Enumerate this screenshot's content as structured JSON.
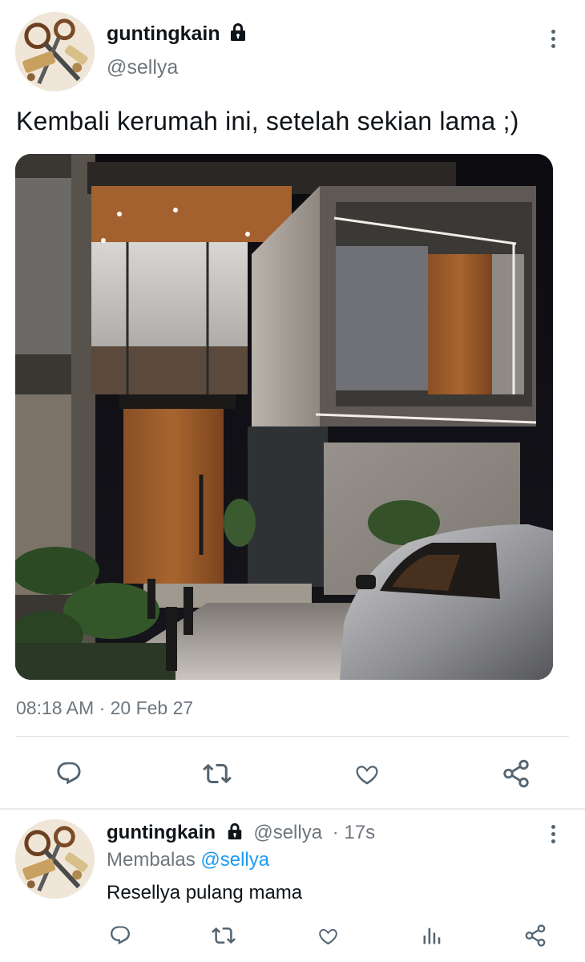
{
  "tweet": {
    "author_name": "guntingkain",
    "author_handle": "@sellya",
    "text": "Kembali kerumah ini, setelah sekian lama ;)",
    "timestamp": "08:18 AM · 20 Feb 27",
    "icons": {
      "lock": "lock-icon",
      "more": "more-vertical-icon",
      "reply": "reply-icon",
      "retweet": "retweet-icon",
      "like": "like-icon",
      "share": "share-icon"
    }
  },
  "reply": {
    "author_name": "guntingkain",
    "author_handle": "@sellya",
    "age": "17s",
    "replying_label": "Membalas",
    "replying_to": "@sellya",
    "text": "Resellya pulang mama",
    "icons": {
      "reply": "reply-icon",
      "retweet": "retweet-icon",
      "like": "like-icon",
      "views": "views-icon",
      "share": "share-icon"
    }
  },
  "colors": {
    "text": "#0f1419",
    "secondary": "#6e767d",
    "link": "#1d9bf0",
    "icon": "#536471"
  }
}
